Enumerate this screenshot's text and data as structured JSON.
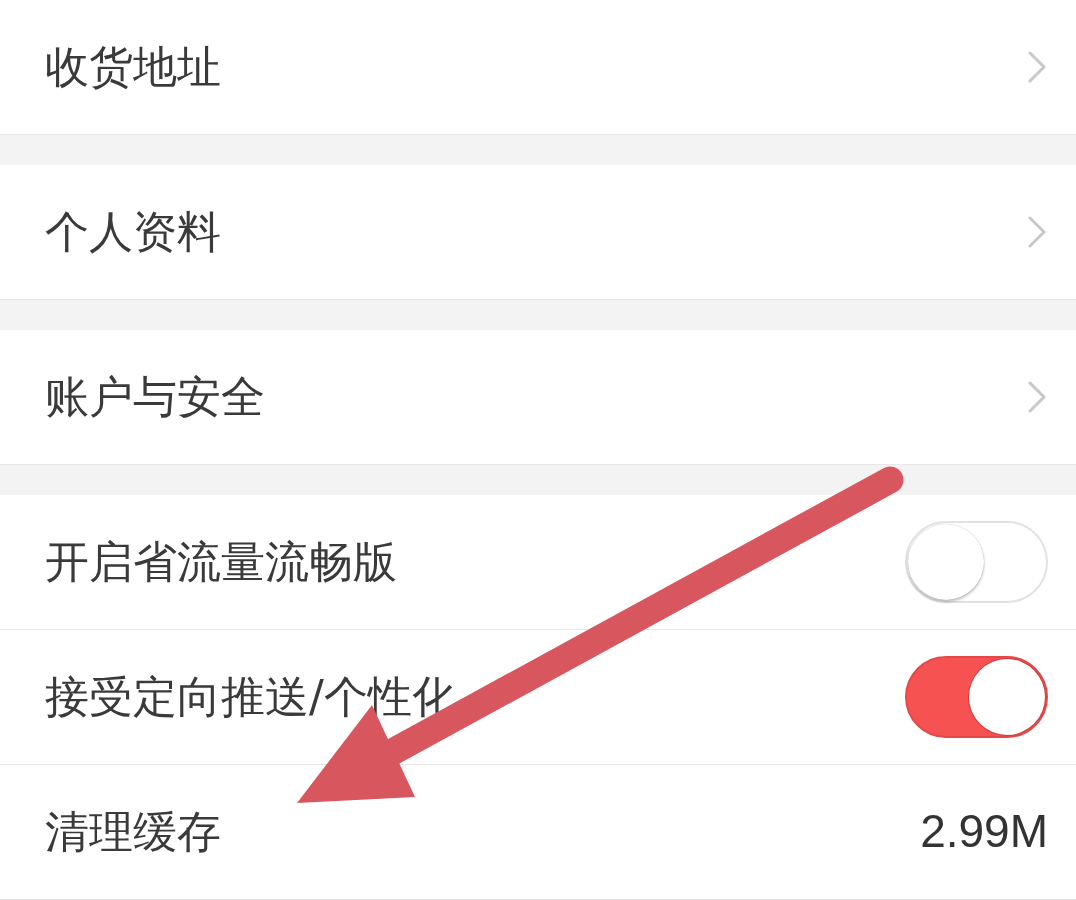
{
  "sections": [
    {
      "items": [
        {
          "kind": "link",
          "label": "收货地址"
        }
      ]
    },
    {
      "items": [
        {
          "kind": "link",
          "label": "个人资料"
        }
      ]
    },
    {
      "items": [
        {
          "kind": "link",
          "label": "账户与安全"
        }
      ]
    },
    {
      "items": [
        {
          "kind": "toggle",
          "label": "开启省流量流畅版",
          "on": false
        },
        {
          "kind": "toggle",
          "label": "接受定向推送/个性化",
          "on": true
        },
        {
          "kind": "value",
          "label": "清理缓存",
          "value": "2.99M"
        }
      ]
    }
  ]
}
